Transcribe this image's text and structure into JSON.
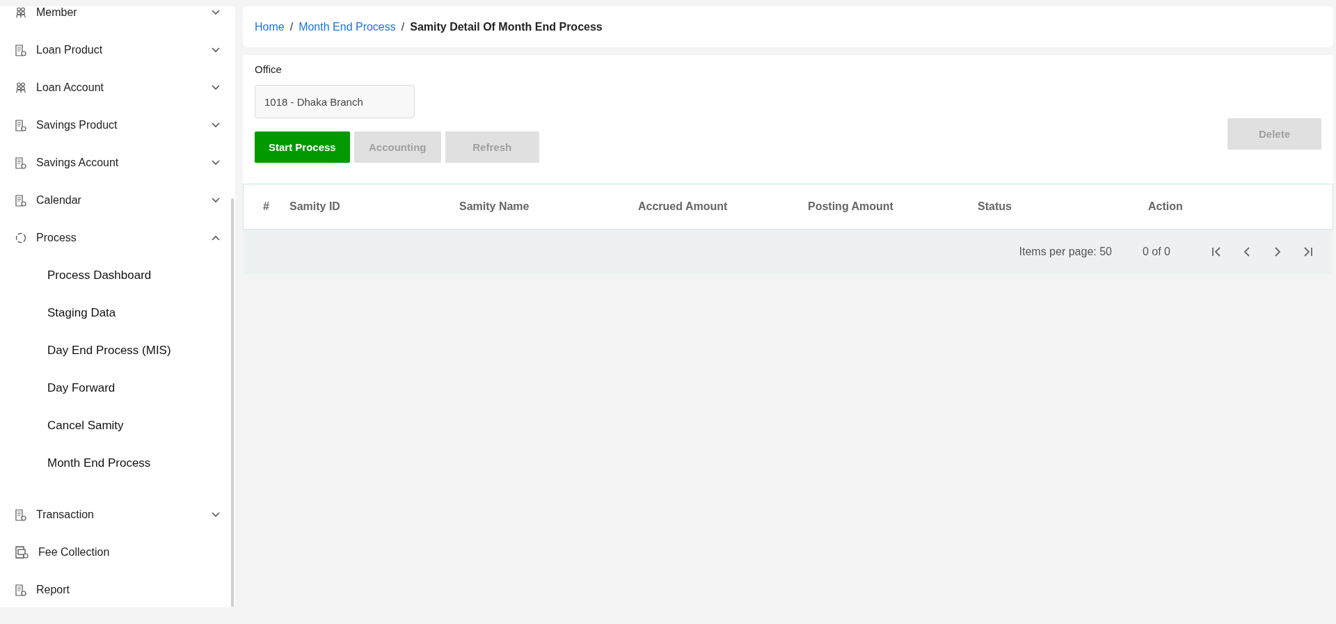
{
  "sidebar": {
    "items": [
      {
        "kind": "people",
        "label": "Member",
        "expanded": false
      },
      {
        "kind": "document",
        "label": "Loan Product",
        "expanded": false
      },
      {
        "kind": "people",
        "label": "Loan Account",
        "expanded": false
      },
      {
        "kind": "document",
        "label": "Savings Product",
        "expanded": false
      },
      {
        "kind": "document",
        "label": "Savings Account",
        "expanded": false
      },
      {
        "kind": "document",
        "label": "Calendar",
        "expanded": false
      },
      {
        "kind": "cycle",
        "label": "Process",
        "expanded": true,
        "children": [
          {
            "label": "Process Dashboard"
          },
          {
            "label": "Staging Data"
          },
          {
            "label": "Day End Process (MIS)"
          },
          {
            "label": "Day Forward"
          },
          {
            "label": "Cancel Samity"
          },
          {
            "label": "Month End Process"
          }
        ]
      },
      {
        "kind": "document",
        "label": "Transaction",
        "expanded": false
      },
      {
        "kind": "fee",
        "label": "Fee Collection"
      },
      {
        "kind": "document",
        "label": "Report"
      }
    ]
  },
  "breadcrumb": [
    {
      "label": "Home",
      "kind": "link"
    },
    {
      "separator": "/",
      "label": "Month End Process",
      "kind": "link"
    },
    {
      "separator": "/",
      "label": "Samity Detail Of Month End Process",
      "kind": "current"
    }
  ],
  "form": {
    "office_label": "Office",
    "office_value": "1018 - Dhaka Branch"
  },
  "buttons": [
    {
      "label": "Start Process",
      "disabled": false
    },
    {
      "label": "Accounting",
      "disabled": true
    },
    {
      "label": "Refresh",
      "disabled": true
    }
  ],
  "delete_button": {
    "label": "Delete",
    "disabled": true
  },
  "table": {
    "columns": [
      "#",
      "Samity ID",
      "Samity Name",
      "Accrued Amount",
      "Posting Amount",
      "Status",
      "Action"
    ]
  },
  "paginator": {
    "items_per_page": "Items per page: 50",
    "range": "0 of 0"
  }
}
